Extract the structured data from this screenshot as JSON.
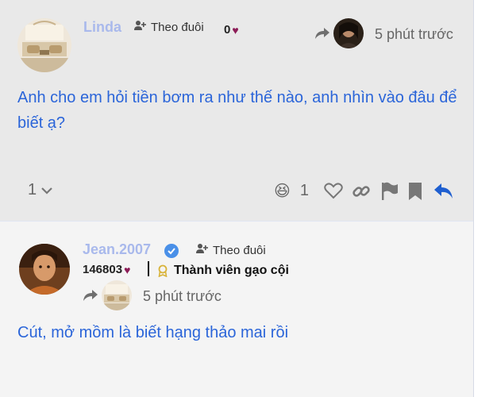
{
  "post1": {
    "username": "Linda",
    "follow_label": "Theo đuôi",
    "score": "0",
    "time": "5 phút trước",
    "content": "Anh cho em hỏi tiền bơm ra như thế nào, anh nhìn vào đâu để biết ạ?",
    "replies_count": "1",
    "reaction_count": "1",
    "reaction_emoji": "😆"
  },
  "post2": {
    "username": "Jean.2007",
    "follow_label": "Theo đuôi",
    "score": "146803",
    "badge": "Thành viên gạo cội",
    "time": "5 phút trước",
    "content": "Cút, mở mồm là biết hạng thảo mai rồi"
  },
  "colors": {
    "username": "#a9b9ec",
    "content": "#2b65d9",
    "heart": "#8c1c57",
    "reply": "#1f5fd0",
    "badge": "#d8b33a"
  },
  "icons": [
    "follow-icon",
    "heart-icon",
    "share-icon",
    "chevron-down-icon",
    "like-icon",
    "link-icon",
    "flag-icon",
    "bookmark-icon",
    "reply-icon",
    "verified-icon",
    "badge-icon"
  ]
}
